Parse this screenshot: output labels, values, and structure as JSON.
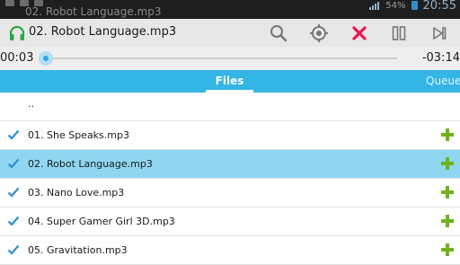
{
  "status_bar": {
    "notification_title": "02. Robot Language.mp3",
    "battery": "54%",
    "time": "20:55"
  },
  "now_playing": {
    "title": "02. Robot Language.mp3",
    "elapsed": "00:03",
    "remaining": "-03:14",
    "progress_fraction": 0.02
  },
  "tabs": [
    {
      "label": "Files",
      "active": true
    },
    {
      "label": "Queue",
      "active": false
    }
  ],
  "file_list": {
    "parent": "..",
    "items": [
      {
        "name": "01. She Speaks.mp3",
        "checked": true,
        "selected": false
      },
      {
        "name": "02. Robot Language.mp3",
        "checked": true,
        "selected": true
      },
      {
        "name": "03. Nano Love.mp3",
        "checked": true,
        "selected": false
      },
      {
        "name": "04. Super Gamer Girl 3D.mp3",
        "checked": true,
        "selected": false
      },
      {
        "name": "05. Gravitation.mp3",
        "checked": true,
        "selected": false
      }
    ]
  },
  "colors": {
    "accent": "#33b5e5",
    "selected_row": "#8fd6f1",
    "close": "#e8174d",
    "add": "#6fb31c"
  }
}
